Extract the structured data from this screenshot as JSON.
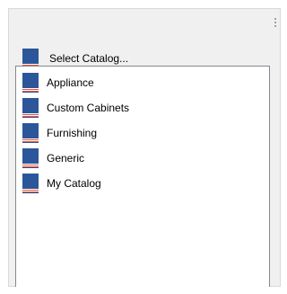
{
  "header": {
    "label": "Select Catalog...",
    "icon": "catalog-book-icon"
  },
  "catalogs": [
    {
      "label": "Appliance",
      "icon": "catalog-book-icon"
    },
    {
      "label": "Custom Cabinets",
      "icon": "catalog-book-icon"
    },
    {
      "label": "Furnishing",
      "icon": "catalog-book-icon"
    },
    {
      "label": "Generic",
      "icon": "catalog-book-icon"
    },
    {
      "label": "My Catalog",
      "icon": "catalog-book-icon"
    }
  ],
  "colors": {
    "book_cover": "#2b579a",
    "book_pages_red": "#e8553a",
    "panel_background": "#f0f0f0",
    "list_background": "#ffffff",
    "list_border": "#828790"
  }
}
